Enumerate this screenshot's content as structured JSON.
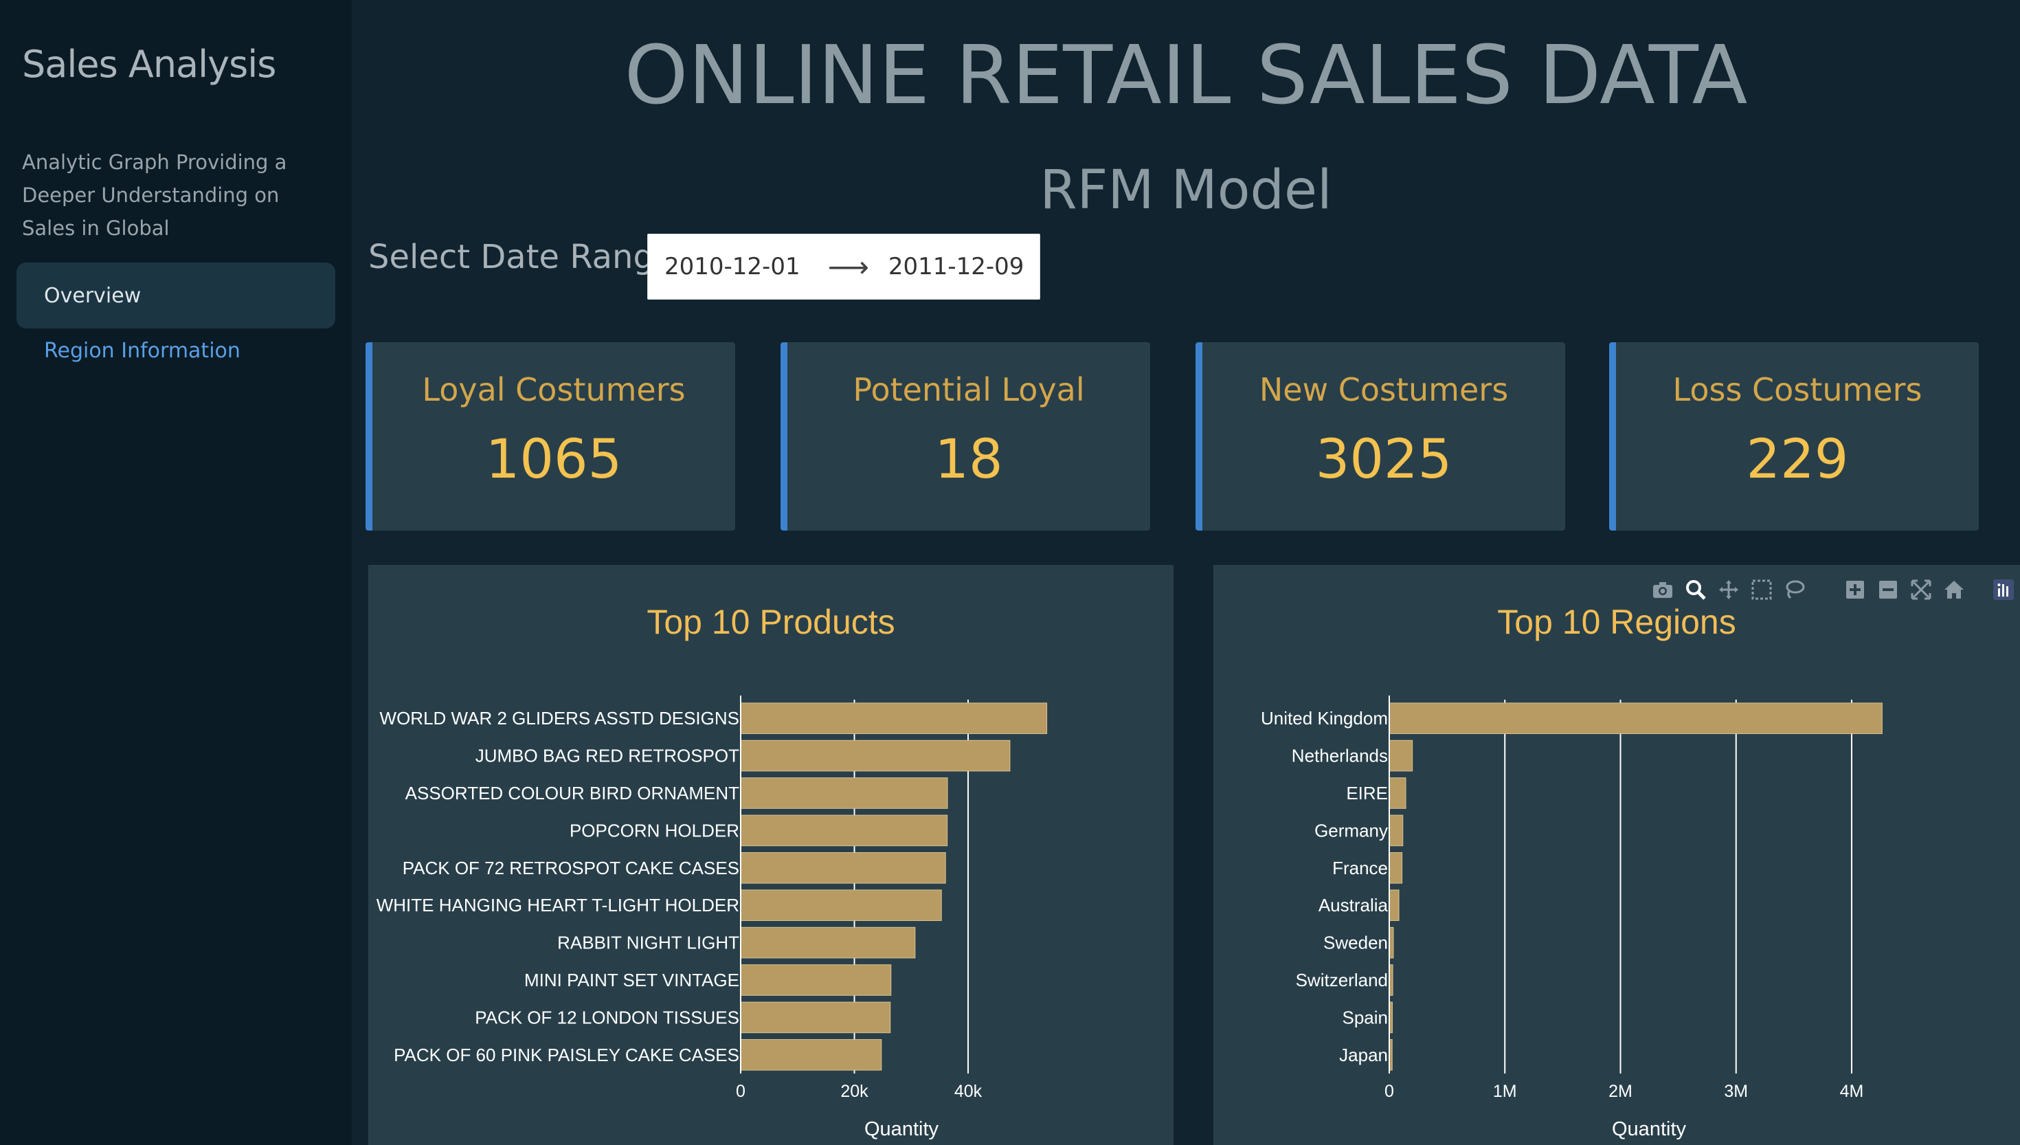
{
  "sidebar": {
    "title": "Sales Analysis",
    "description": "Analytic Graph Providing a Deeper Understanding on Sales in Global",
    "items": [
      {
        "label": "Overview"
      },
      {
        "label": "Region Information"
      }
    ]
  },
  "header": {
    "title": "ONLINE RETAIL SALES DATA",
    "subtitle": "RFM Model"
  },
  "date_range": {
    "label": "Select Date Range:",
    "start": "2010-12-01",
    "arrow": "⟶",
    "end": "2011-12-09"
  },
  "kpis": [
    {
      "title": "Loyal Costumers",
      "value": "1065"
    },
    {
      "title": "Potential Loyal",
      "value": "18"
    },
    {
      "title": "New Costumers",
      "value": "3025"
    },
    {
      "title": "Loss Costumers",
      "value": "229"
    }
  ],
  "colors": {
    "bar": "#b89b62",
    "accent_title": "#f2bd55",
    "kpi_value": "#f4c24f",
    "kpi_border": "#3d83cf",
    "link": "#5b9fe6"
  },
  "modebar": {
    "icons": [
      "camera-icon",
      "zoom-icon",
      "pan-icon",
      "box-select-icon",
      "lasso-icon",
      "zoom-in-icon",
      "zoom-out-icon",
      "autoscale-icon",
      "reset-axes-icon",
      "plotly-logo-icon"
    ]
  },
  "chart_data": [
    {
      "type": "bar",
      "orientation": "horizontal",
      "title": "Top 10 Products",
      "xlabel": "Quantity",
      "categories": [
        "WORLD WAR 2 GLIDERS ASSTD DESIGNS",
        "JUMBO BAG RED RETROSPOT",
        "ASSORTED COLOUR BIRD ORNAMENT",
        "POPCORN HOLDER",
        "PACK OF 72 RETROSPOT CAKE CASES",
        "WHITE HANGING HEART T-LIGHT HOLDER",
        "RABBIT NIGHT LIGHT",
        "MINI PAINT SET VINTAGE",
        "PACK OF 12 LONDON TISSUES",
        "PACK OF 60 PINK PAISLEY CAKE CASES"
      ],
      "values": [
        53847,
        47363,
        36381,
        36334,
        36039,
        35317,
        30680,
        26437,
        26315,
        24753
      ],
      "xlim": [
        0,
        55000
      ],
      "xticks": [
        0,
        20000,
        40000
      ],
      "xtick_labels": [
        "0",
        "20k",
        "40k"
      ],
      "grid": true
    },
    {
      "type": "bar",
      "orientation": "horizontal",
      "title": "Top 10 Regions",
      "xlabel": "Quantity",
      "categories": [
        "United Kingdom",
        "Netherlands",
        "EIRE",
        "Germany",
        "France",
        "Australia",
        "Sweden",
        "Switzerland",
        "Spain",
        "Japan"
      ],
      "values": [
        4263829,
        200128,
        142637,
        117448,
        110480,
        83653,
        35637,
        30325,
        26824,
        25218
      ],
      "xlim": [
        0,
        4500000
      ],
      "xticks": [
        0,
        1000000,
        2000000,
        3000000,
        4000000
      ],
      "xtick_labels": [
        "0",
        "1M",
        "2M",
        "3M",
        "4M"
      ],
      "grid": true
    }
  ]
}
